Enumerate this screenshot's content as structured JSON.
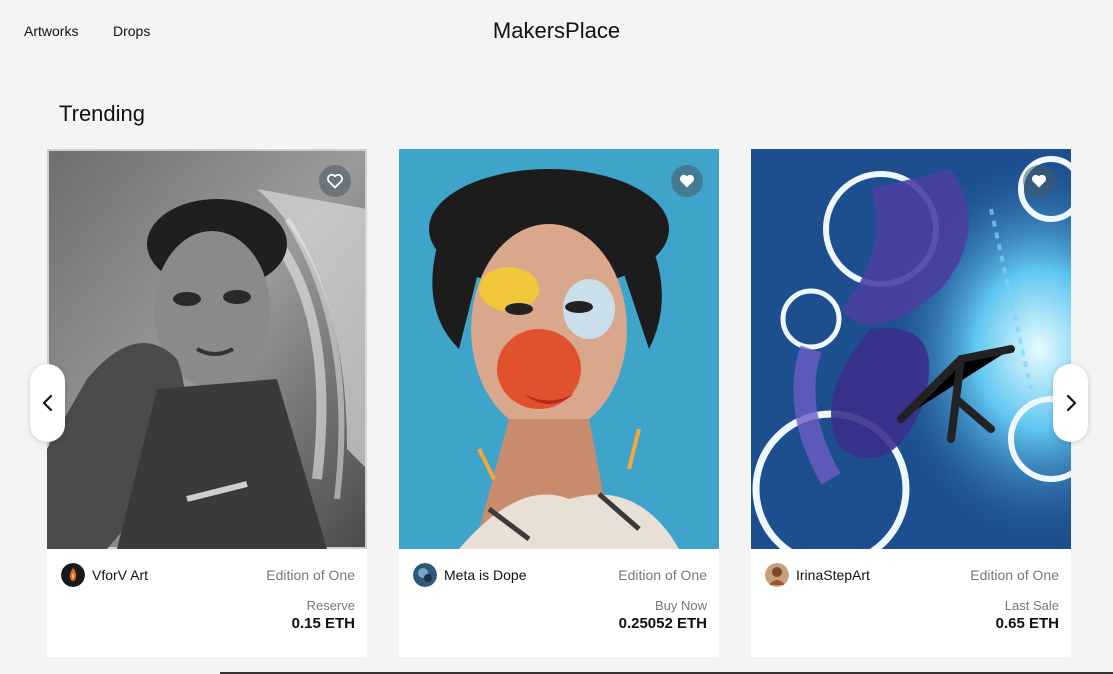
{
  "nav": {
    "links": [
      "Artworks",
      "Drops"
    ],
    "brand": "MakersPlace"
  },
  "section": {
    "title": "Trending"
  },
  "carousel": {
    "prev_icon": "chevron-left-icon",
    "next_icon": "chevron-right-icon"
  },
  "cards": [
    {
      "artist": "VforV Art",
      "edition": "Edition of One",
      "price_label": "Reserve",
      "price": "0.15 ETH",
      "favorite_icon": "heart-outline-icon"
    },
    {
      "artist": "Meta is Dope",
      "edition": "Edition of One",
      "price_label": "Buy Now",
      "price": "0.25052 ETH",
      "favorite_icon": "heart-filled-icon"
    },
    {
      "artist": "IrinaStepArt",
      "edition": "Edition of One",
      "price_label": "Last Sale",
      "price": "0.65 ETH",
      "favorite_icon": "heart-filled-icon"
    }
  ],
  "colors": {
    "background": "#f4f4f4",
    "text": "#111111",
    "muted": "#777777"
  }
}
